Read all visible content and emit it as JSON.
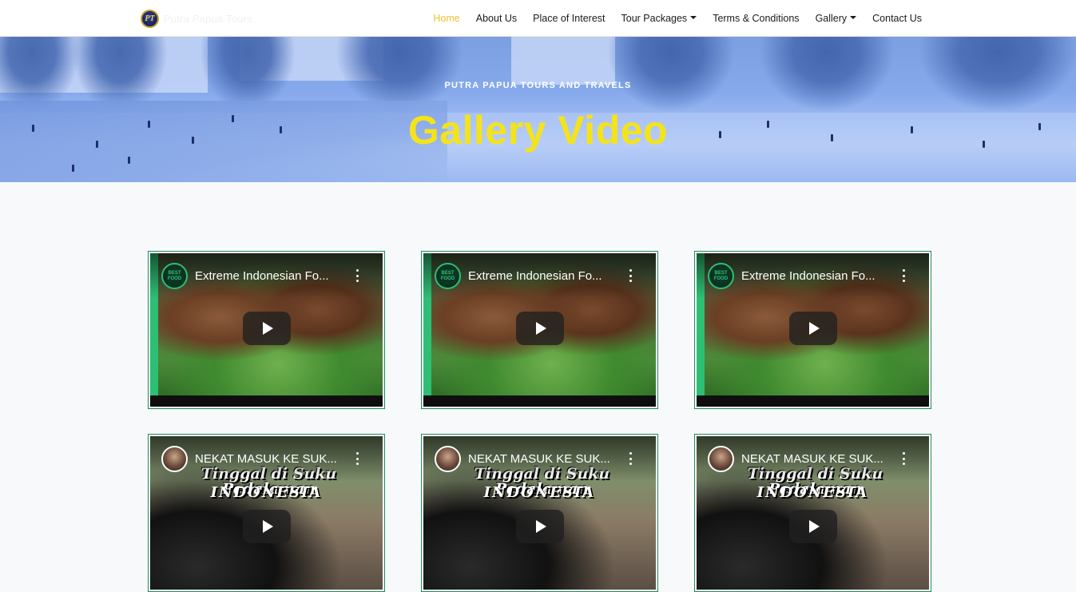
{
  "brand": {
    "logo_text": "PT",
    "name": "Putra Papua Tours"
  },
  "nav": {
    "items": [
      {
        "label": "Home",
        "active": true,
        "dropdown": false
      },
      {
        "label": "About Us",
        "active": false,
        "dropdown": false
      },
      {
        "label": "Place of Interest",
        "active": false,
        "dropdown": false
      },
      {
        "label": "Tour Packages",
        "active": false,
        "dropdown": true
      },
      {
        "label": "Terms & Conditions",
        "active": false,
        "dropdown": false
      },
      {
        "label": "Gallery",
        "active": false,
        "dropdown": true
      },
      {
        "label": "Contact Us",
        "active": false,
        "dropdown": false
      }
    ]
  },
  "hero": {
    "subtitle": "PUTRA PAPUA TOURS AND TRAVELS",
    "title": "Gallery Video"
  },
  "videos": [
    {
      "title": "Extreme Indonesian Fo...",
      "channel_icon": "channel-badge-icon",
      "thumb": "food"
    },
    {
      "title": "Extreme Indonesian Fo...",
      "channel_icon": "channel-badge-icon",
      "thumb": "food"
    },
    {
      "title": "Extreme Indonesian Fo...",
      "channel_icon": "channel-badge-icon",
      "thumb": "food"
    },
    {
      "title": "NEKAT MASUK KE SUK...",
      "channel_icon": "channel-avatar-icon",
      "thumb": "tribe",
      "banner_line1": "Tinggal di Suku Pedalaman",
      "banner_line2": "INDONESIA"
    },
    {
      "title": "NEKAT MASUK KE SUK...",
      "channel_icon": "channel-avatar-icon",
      "thumb": "tribe",
      "banner_line1": "Tinggal di Suku Pedalaman",
      "banner_line2": "INDONESIA"
    },
    {
      "title": "NEKAT MASUK KE SUK...",
      "channel_icon": "channel-avatar-icon",
      "thumb": "tribe",
      "banner_line1": "Tinggal di Suku Pedalaman",
      "banner_line2": "INDONESIA"
    }
  ],
  "colors": {
    "accent": "#f2c12e",
    "hero_title": "#f5e31a",
    "card_border": "#1f8a5a"
  }
}
